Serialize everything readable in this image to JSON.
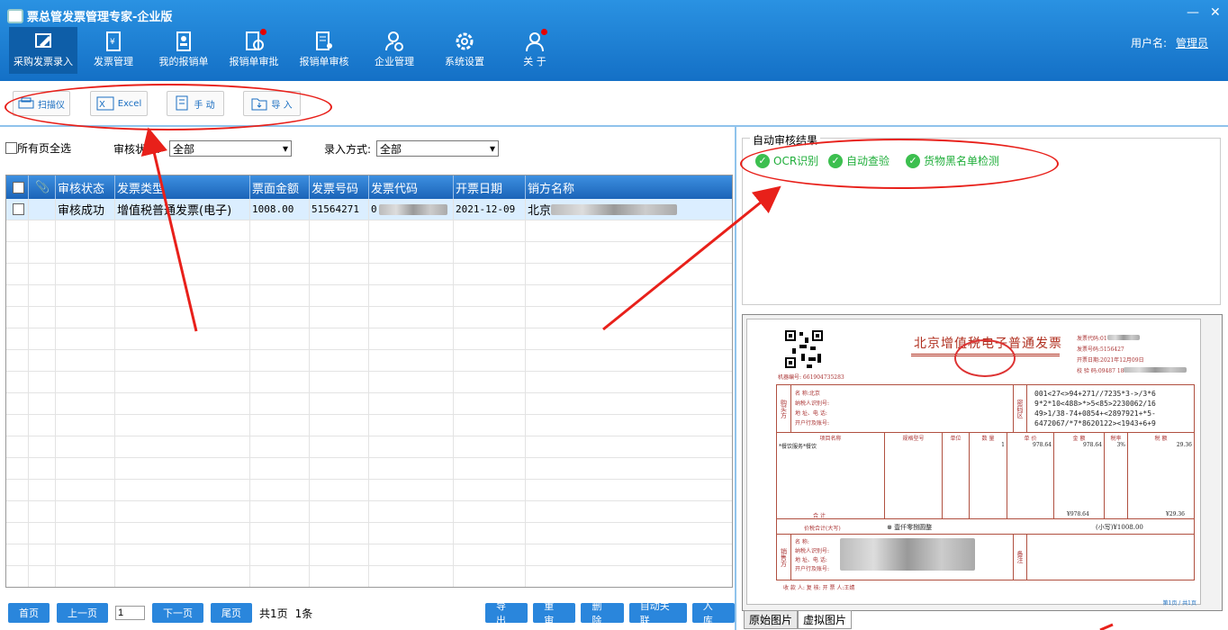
{
  "app": {
    "title": "票总管发票管理专家-企业版",
    "user_label": "用户名:",
    "user_name": "管理员"
  },
  "nav": [
    {
      "label": "采购发票录入",
      "icon": "pen-doc-icon",
      "active": true
    },
    {
      "label": "发票管理",
      "icon": "invoice-yen-icon"
    },
    {
      "label": "我的报销单",
      "icon": "person-doc-icon"
    },
    {
      "label": "报销单审批",
      "icon": "approve-doc-icon",
      "badge": true
    },
    {
      "label": "报销单审核",
      "icon": "review-doc-icon"
    },
    {
      "label": "企业管理",
      "icon": "user-gear-icon"
    },
    {
      "label": "系统设置",
      "icon": "gear-icon"
    },
    {
      "label": "关 于",
      "icon": "info-person-icon",
      "badge": true
    }
  ],
  "toolbar": {
    "scanner": "扫描仪",
    "excel": "Excel",
    "manual": "手 动",
    "import": "导 入"
  },
  "filters": {
    "select_all": "所有页全选",
    "audit_label": "审核状态:",
    "audit_value": "全部",
    "entry_label": "录入方式:",
    "entry_value": "全部"
  },
  "grid": {
    "columns": [
      "审核状态",
      "发票类型",
      "票面金额",
      "发票号码",
      "发票代码",
      "开票日期",
      "销方名称"
    ],
    "rows": [
      {
        "status": "审核成功",
        "type": "增值税普通发票(电子)",
        "amount": "1008.00",
        "number": "51564271",
        "code": "0",
        "date": "2021-12-09",
        "seller": "北京"
      }
    ]
  },
  "pager": {
    "first": "首页",
    "prev": "上一页",
    "page": "1",
    "next": "下一页",
    "last": "尾页",
    "total_pages": "共1页",
    "total_rows": "1条"
  },
  "actions": {
    "export": "导 出",
    "reaudit": "重 审",
    "delete": "删 除",
    "autolink": "自动关联",
    "store": "入 库"
  },
  "audit": {
    "title": "自动审核结果",
    "checks": [
      "OCR识别",
      "自动查验",
      "货物黑名单检测"
    ]
  },
  "invoice": {
    "title": "北京增值税电子普通发票",
    "machine_no": "机器编号: 661904735283",
    "code_label": "发票代码:",
    "code_value": "01",
    "number_label": "发票号码:",
    "number_value": "5156427",
    "date_label": "开票日期:",
    "date_value": "2021年12月09日",
    "check_label": "校 验 码:",
    "check_value": "09487 18",
    "cipher": [
      "001<27<>94+271//7235*3->/3*6",
      "9*2*10<488>*>5<85>2230062/16",
      "49>1/38-74+0854+<2897921+*5-",
      "6472067/*7*8620122><1943+6+9"
    ],
    "buyer_rows": [
      "名 称:北京",
      "纳税人识别号:",
      "地 址、电 话:",
      "开户行及账号:"
    ],
    "buyer_label": "购买方",
    "cipher_label": "密码区",
    "item_headers": [
      "项目名称",
      "规格型号",
      "单位",
      "数 量",
      "单 价",
      "金 额",
      "税率",
      "税 额"
    ],
    "item": {
      "name": "*餐饮服务*餐饮",
      "qty": "1",
      "price": "978.64",
      "amount": "978.64",
      "rate": "3%",
      "tax": "29.36"
    },
    "total_label": "合 计",
    "total_amount": "¥978.64",
    "total_tax": "¥29.36",
    "sum_label": "价税合计(大写)",
    "sum_words": "壹仟零捌圆整",
    "sum_small": "(小写)¥1008.00",
    "seller_label": "销售方",
    "seller_rows": [
      "名 称:",
      "纳税人识别号:",
      "地 址、电 话:",
      "开户行及账号:"
    ],
    "note_label": "备注",
    "footer": "收 款 人:          复 核:          开 票 人:王婧",
    "page_note": "第1页 / 共1页"
  },
  "image_tabs": [
    "原始图片",
    "虚拟图片"
  ]
}
